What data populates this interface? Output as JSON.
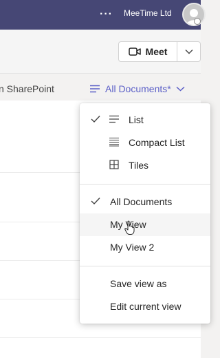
{
  "topbar": {
    "more_label": "···",
    "org_name": "MeeTime Ltd",
    "avatar_icon": "user-avatar-icon",
    "status": "offline"
  },
  "header": {
    "meet_label": "Meet",
    "meet_icon": "video-camera-icon",
    "caret_icon": "chevron-down-icon"
  },
  "toolbar": {
    "breadcrumb": "n SharePoint",
    "view_label": "All Documents*",
    "view_icon": "list-lines-icon"
  },
  "menu": {
    "layouts": [
      {
        "label": "List",
        "checked": true,
        "icon": "list-lines-icon"
      },
      {
        "label": "Compact List",
        "checked": false,
        "icon": "compact-list-icon"
      },
      {
        "label": "Tiles",
        "checked": false,
        "icon": "tiles-grid-icon"
      }
    ],
    "views": [
      {
        "label": "All Documents",
        "checked": true
      },
      {
        "label": "My View",
        "checked": false,
        "hovered": true
      },
      {
        "label": "My View 2",
        "checked": false
      }
    ],
    "actions": [
      {
        "label": "Save view as"
      },
      {
        "label": "Edit current view"
      }
    ]
  },
  "colors": {
    "topbar": "#464775",
    "accent": "#5b5fc7",
    "text": "#242424"
  }
}
